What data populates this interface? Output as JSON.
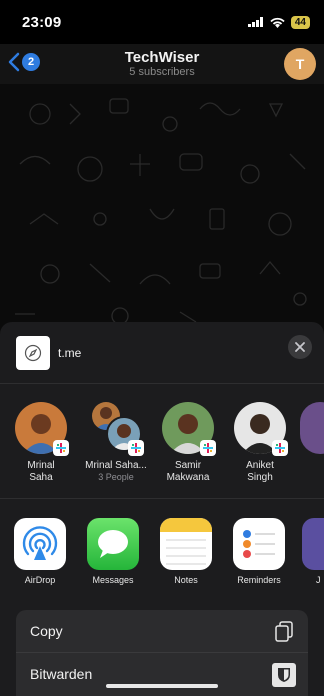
{
  "status_bar": {
    "time": "23:09",
    "battery": "44"
  },
  "header": {
    "back_count": "2",
    "title": "TechWiser",
    "subtitle": "5 subscribers",
    "avatar_letter": "T"
  },
  "share": {
    "link_text": "t.me",
    "people": [
      {
        "name": "Mrinal\nSaha",
        "sub": ""
      },
      {
        "name": "Mrinal Saha...",
        "sub": "3 People"
      },
      {
        "name": "Samir\nMakwana",
        "sub": ""
      },
      {
        "name": "Aniket\nSingh",
        "sub": ""
      }
    ],
    "apps": [
      {
        "label": "AirDrop"
      },
      {
        "label": "Messages"
      },
      {
        "label": "Notes"
      },
      {
        "label": "Reminders"
      },
      {
        "label": "J"
      }
    ],
    "actions": [
      {
        "label": "Copy"
      },
      {
        "label": "Bitwarden"
      }
    ]
  },
  "colors": {
    "accent": "#2f7ce0",
    "sheet_bg": "#1c1c1e",
    "avatar_bg": "#e0a662"
  }
}
